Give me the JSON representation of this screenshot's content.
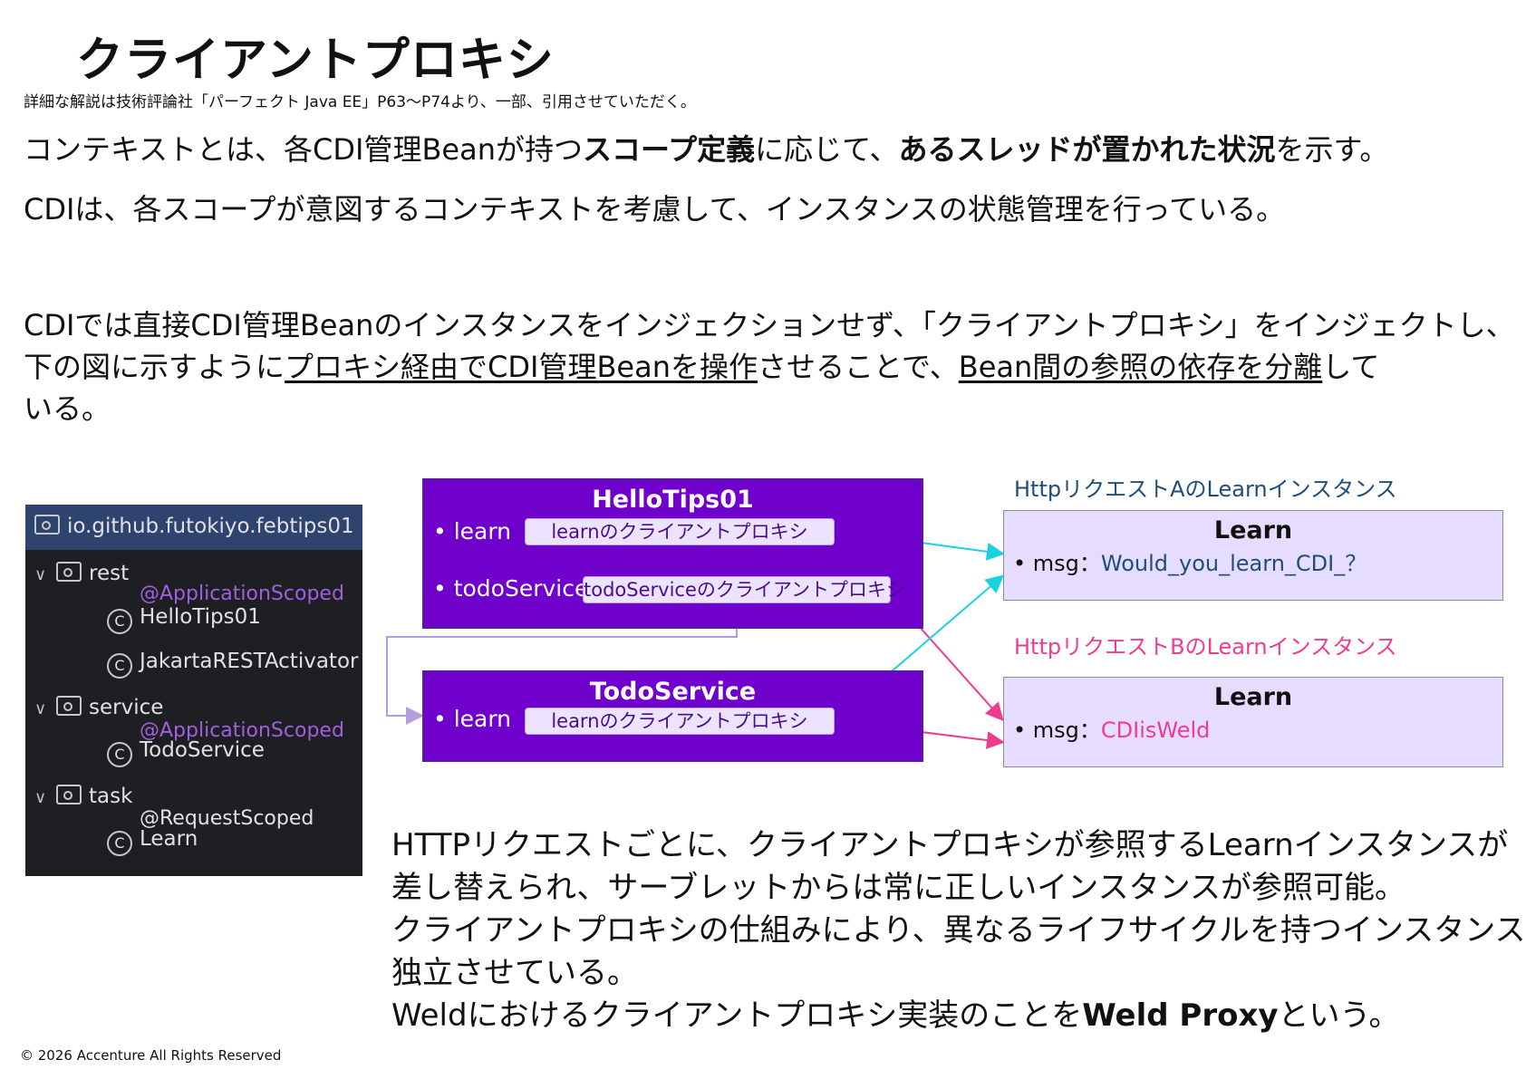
{
  "title": "クライアントプロキシ",
  "source_note": "詳細な解説は技術評論社「パーフェクト Java EE」P63～P74より、一部、引用させていただく。",
  "intro": {
    "p1": {
      "a": "コンテキストとは、各CDI管理Beanが持つ",
      "b": "スコープ定義",
      "c": "に応じて、",
      "d": "あるスレッドが置かれた状況",
      "e": "を示す。"
    },
    "p2": "CDIは、各スコープが意図するコンテキストを考慮して、インスタンスの状態管理を行っている。",
    "p3": {
      "line1": "CDIでは直接CDI管理Beanのインスタンスをインジェクションせず、「クライアントプロキシ」をインジェクトし、",
      "line2a": "下の図に示すように",
      "line2b": "プロキシ経由でCDI管理Beanを操作",
      "line2c": "させることで、",
      "line2d": "Bean間の参照の依存を分離",
      "line2e": "して",
      "line3": "いる。"
    }
  },
  "tree": {
    "root": "io.github.futokiyo.febtips01",
    "packages": [
      {
        "name": "rest",
        "annotation": "@ApplicationScoped",
        "classes": [
          "HelloTips01",
          "JakartaRESTActivator"
        ]
      },
      {
        "name": "service",
        "annotation": "@ApplicationScoped",
        "classes": [
          "TodoService"
        ]
      },
      {
        "name": "task",
        "annotation": "@RequestScoped",
        "classes": [
          "Learn"
        ]
      }
    ],
    "chevron": "chevron-down-icon",
    "folder": "package-folder-icon",
    "class": "class-c-icon"
  },
  "diagram": {
    "hello": {
      "title": "HelloTips01",
      "field1": "• learn",
      "proxy1": "learnのクライアントプロキシ",
      "field2": "• todoService",
      "proxy2": "todoServiceのクライアントプロキシ"
    },
    "todo": {
      "title": "TodoService",
      "field1": "• learn",
      "proxy1": "learnのクライアントプロキシ"
    },
    "instA": {
      "caption": "HttpリクエストAのLearnインスタンス",
      "title": "Learn",
      "label": "• msg：",
      "value": "Would_you_learn_CDI_？"
    },
    "instB": {
      "caption": "HttpリクエストBのLearnインスタンス",
      "title": "Learn",
      "label": "• msg：",
      "value": "CDIisWeld"
    },
    "colors": {
      "bean": "#7000cc",
      "cyan": "#1ad1e0",
      "pink": "#ee3d8f",
      "connector": "#b39ddb"
    }
  },
  "body2": {
    "l1": "HTTPリクエストごとに、クライアントプロキシが参照するLearnインスタンスが",
    "l2": "差し替えられ、サーブレットからは常に正しいインスタンスが参照可能。",
    "l3": "クライアントプロキシの仕組みにより、異なるライフサイクルを持つインスタンスを",
    "l4": "独立させている。",
    "l5a": "Weldにおけるクライアントプロキシ実装のことを",
    "l5b": "Weld Proxy",
    "l5c": "という。"
  },
  "copyright": "© 2026 Accenture All Rights Reserved"
}
